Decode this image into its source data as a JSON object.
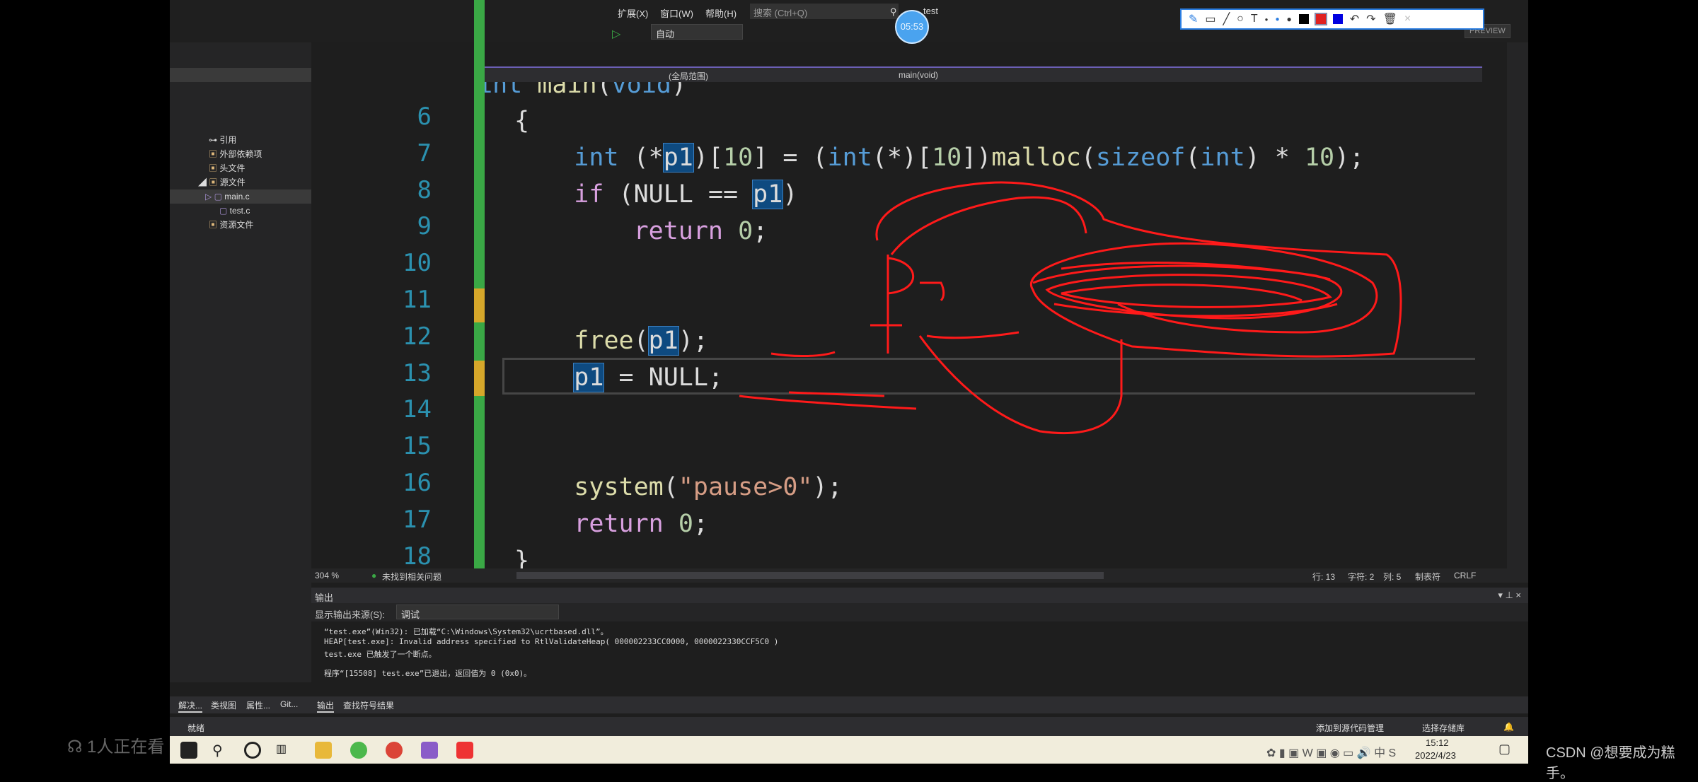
{
  "menu": {
    "items": [
      "扩展(X)",
      "窗口(W)",
      "帮助(H)"
    ],
    "search_placeholder": "搜索 (Ctrl+Q)",
    "solution_name": "test",
    "preview": "PREVIEW"
  },
  "toolbar": {
    "config": "自动"
  },
  "timer": "05:53",
  "annotation_toolbar": {
    "tools": [
      "pen-icon",
      "rectangle-icon",
      "line-icon",
      "circle-icon",
      "text-icon",
      "dot-small",
      "dot-medium",
      "dot-large"
    ],
    "colors": [
      "#000000",
      "#e02020",
      "#0000e0"
    ],
    "actions": [
      "undo-icon",
      "redo-icon",
      "trash-icon",
      "close-icon"
    ]
  },
  "solution_explorer": {
    "items": [
      {
        "label": "引用",
        "indent": 1
      },
      {
        "label": "外部依赖项",
        "indent": 1
      },
      {
        "label": "头文件",
        "indent": 1
      },
      {
        "label": "源文件",
        "indent": 1
      },
      {
        "label": "main.c",
        "indent": 2
      },
      {
        "label": "test.c",
        "indent": 2
      },
      {
        "label": "资源文件",
        "indent": 1
      }
    ],
    "tabs": [
      "解决...",
      "类视图",
      "属性...",
      "Git..."
    ]
  },
  "scope": {
    "left": "",
    "middle": "(全局范围)",
    "right": "main(void)"
  },
  "code": {
    "partial_line": "int main(void)",
    "line_numbers": [
      "6",
      "7",
      "8",
      "9",
      "10",
      "11",
      "12",
      "13",
      "14",
      "15",
      "16",
      "17",
      "18"
    ],
    "last_line": "}"
  },
  "editor_status": {
    "zoom": "304 %",
    "issues": "未找到相关问题",
    "line": "行: 13",
    "char": "字符: 2",
    "col": "列: 5",
    "tabs": "制表符",
    "eol": "CRLF"
  },
  "output": {
    "title": "输出",
    "source_label": "显示输出来源(S):",
    "source_value": "调试",
    "lines": [
      "“test.exe”(Win32): 已加载“C:\\Windows\\System32\\ucrtbased.dll”。",
      "HEAP[test.exe]: Invalid address specified to RtlValidateHeap( 000002233CC0000, 0000022330CCF5C0 )",
      "test.exe 已触发了一个断点。",
      "",
      "程序“[15508] test.exe”已退出，返回值为 0 (0x0)。"
    ],
    "tabs": [
      "输出",
      "查找符号结果"
    ]
  },
  "status": {
    "ready": "就绪",
    "source_control": "添加到源代码管理",
    "repo": "选择存储库"
  },
  "taskbar": {
    "time": "15:12",
    "date": "2022/4/23"
  },
  "overlay": {
    "viewers": "1人正在看",
    "watermark": "CSDN @想要成为糕手。"
  },
  "colors": {
    "accent": "#3aa845",
    "annotation": "#ff1a1a"
  }
}
